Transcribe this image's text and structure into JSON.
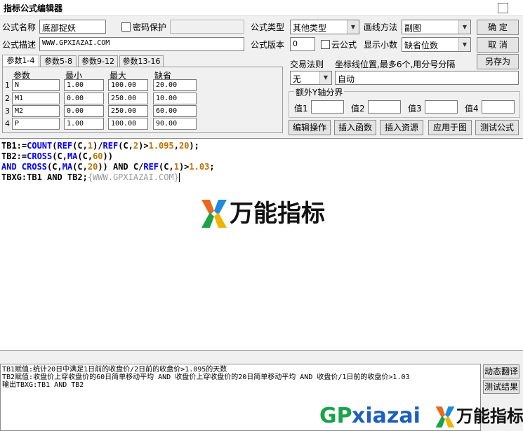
{
  "window": {
    "title": "指标公式编辑器"
  },
  "form": {
    "name_label": "公式名称",
    "name_value": "底部捉妖",
    "password_label": "密码保护",
    "desc_label": "公式描述",
    "desc_value": "WWW.GPXIAZAI.COM",
    "type_label": "公式类型",
    "type_value": "其他类型",
    "draw_label": "画线方法",
    "draw_value": "副图",
    "version_label": "公式版本",
    "version_value": "0",
    "cloud_label": "云公式",
    "decimal_label": "显示小数",
    "decimal_value": "缺省位数"
  },
  "buttons": {
    "ok": "确  定",
    "cancel": "取  消",
    "save_as": "另存为",
    "edit_ops": "编辑操作",
    "insert_func": "插入函数",
    "insert_res": "插入资源",
    "apply_chart": "应用于图",
    "test": "测试公式",
    "dyn_translate": "动态翻译",
    "test_result": "测试结果"
  },
  "params": {
    "tabs": [
      "参数1-4",
      "参数5-8",
      "参数9-12",
      "参数13-16"
    ],
    "headers": [
      "参数",
      "最小",
      "最大",
      "缺省"
    ],
    "rows": [
      {
        "idx": "1",
        "name": "N",
        "min": "1.00",
        "max": "100.00",
        "def": "20.00"
      },
      {
        "idx": "2",
        "name": "M1",
        "min": "0.00",
        "max": "250.00",
        "def": "10.00"
      },
      {
        "idx": "3",
        "name": "M2",
        "min": "0.00",
        "max": "250.00",
        "def": "60.00"
      },
      {
        "idx": "4",
        "name": "P",
        "min": "1.00",
        "max": "100.00",
        "def": "90.00"
      }
    ]
  },
  "trade": {
    "label": "交易法则",
    "value": "无"
  },
  "coord": {
    "label": "坐标线位置,最多6个,用分号分隔",
    "value": "自动"
  },
  "yaxis": {
    "label": "额外Y轴分界",
    "v1": "值1",
    "v2": "值2",
    "v3": "值3",
    "v4": "值4"
  },
  "code": {
    "l1": {
      "a": "TB1:=",
      "b": "COUNT",
      "c": "(",
      "d": "REF",
      "e": "(C,",
      "f": "1",
      "g": ")/",
      "h": "REF",
      "i": "(C,",
      "j": "2",
      "k": ")>",
      "l": "1.095",
      "m": ",",
      "n": "20",
      "o": ");"
    },
    "l2": {
      "a": "TB2:=",
      "b": "CROSS",
      "c": "(C,",
      "d": "MA",
      "e": "(C,",
      "f": "60",
      "g": "))"
    },
    "l3": {
      "a": "AND ",
      "b": "CROSS",
      "c": "(C,",
      "d": "MA",
      "e": "(C,",
      "f": "20",
      "g": ")) AND C/",
      "h": "REF",
      "i": "(C,",
      "j": "1",
      "k": ")>",
      "l": "1.03",
      "m": ";"
    },
    "l4": {
      "a": "TBXG:TB1 AND TB2;",
      "b": "{WWW.GPXIAZAI.COM}"
    }
  },
  "output": {
    "line1": "TB1赋值:统计20日中满足1日前的收盘价/2日前的收盘价>1.095的天数",
    "line2": "TB2赋值:收盘价上穿收盘价的60日简单移动平均 AND 收盘价上穿收盘价的20日简单移动平均 AND 收盘价/1日前的收盘价>1.03",
    "line3": "输出TBXG:TB1 AND TB2"
  },
  "watermark": {
    "brand_cn": "万能指标",
    "site_gp": "GP",
    "site_rest": "xiazai"
  },
  "colors": {
    "keyword": "#0000ff",
    "number": "#c07000",
    "comment": "#9a9a9a",
    "gp_green": "#1aa34a",
    "site_blue": "#1d5fbf"
  }
}
